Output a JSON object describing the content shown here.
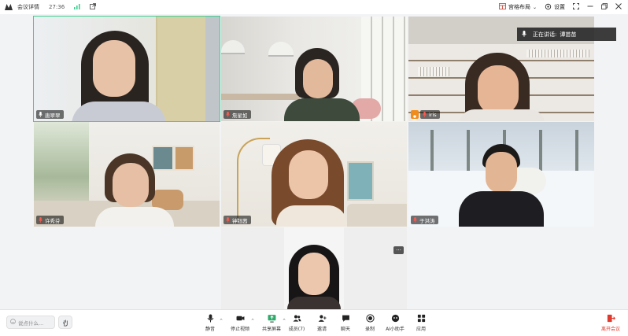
{
  "topbar": {
    "meeting_details": "会议详情",
    "timer": "27:36",
    "layout_label": "宫格布局",
    "settings_label": "设置"
  },
  "speaking": {
    "label": "正在讲话:",
    "name": "谭苗苗"
  },
  "participants": [
    {
      "name": "唐翠翠",
      "active": true
    },
    {
      "name": "詹星如",
      "active": false
    },
    {
      "name": "iris",
      "active": false
    },
    {
      "name": "许秀芬",
      "active": false
    },
    {
      "name": "钟钰茜",
      "active": false
    },
    {
      "name": "于洪涛",
      "active": false
    },
    {
      "name": "",
      "active": false
    }
  ],
  "toolbar": {
    "chat_placeholder": "说点什么...",
    "items": [
      {
        "label": "静音",
        "icon": "microphone-icon"
      },
      {
        "label": "停止视频",
        "icon": "camera-icon"
      },
      {
        "label": "共享屏幕",
        "icon": "share-screen-icon"
      },
      {
        "label": "成员(7)",
        "icon": "members-icon"
      },
      {
        "label": "邀请",
        "icon": "invite-icon"
      },
      {
        "label": "聊天",
        "icon": "chat-icon"
      },
      {
        "label": "录制",
        "icon": "record-icon"
      },
      {
        "label": "AI小助手",
        "icon": "ai-assistant-icon"
      },
      {
        "label": "应用",
        "icon": "apps-icon"
      }
    ],
    "leave_label": "离开会议"
  },
  "colors": {
    "active_border": "#3ccf91",
    "leave": "#e03a2f",
    "signal": "#3ccf91"
  }
}
